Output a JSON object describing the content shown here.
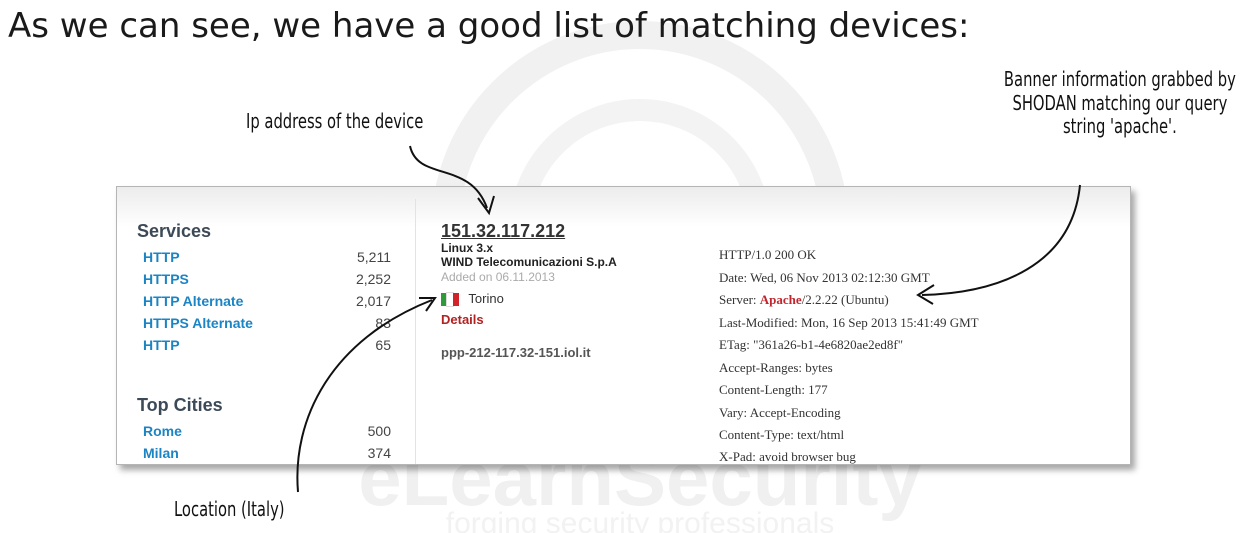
{
  "slide": {
    "title": "As we can see, we have a good list of matching devices:"
  },
  "annotations": {
    "ip_note": "Ip address of the device",
    "banner_note_line1": "Banner information grabbed by",
    "banner_note_line2": "SHODAN matching our query",
    "banner_note_line3": "string 'apache'.",
    "location_note": "Location (Italy)"
  },
  "watermark": {
    "line1": "eLearnSecurity",
    "line2": "forging security professionals"
  },
  "sidebar": {
    "services_title": "Services",
    "services": [
      {
        "name": "HTTP",
        "count": "5,211"
      },
      {
        "name": "HTTPS",
        "count": "2,252"
      },
      {
        "name": "HTTP Alternate",
        "count": "2,017"
      },
      {
        "name": "HTTPS Alternate",
        "count": "83"
      },
      {
        "name": "HTTP",
        "count": "65"
      }
    ],
    "cities_title": "Top Cities",
    "cities": [
      {
        "name": "Rome",
        "count": "500"
      },
      {
        "name": "Milan",
        "count": "374"
      }
    ]
  },
  "result": {
    "ip": "151.32.117.212",
    "os": "Linux 3.x",
    "org": "WIND Telecomunicazioni S.p.A",
    "added": "Added on 06.11.2013",
    "city": "Torino",
    "details": "Details",
    "hostname": "ppp-212-117.32-151.iol.it",
    "flag_colors": [
      "#2e9a3a",
      "#ffffff",
      "#d2232a"
    ]
  },
  "banner": {
    "lines": [
      "HTTP/1.0 200 OK",
      "Date: Wed, 06 Nov 2013 02:12:30 GMT",
      "",
      "Last-Modified: Mon, 16 Sep 2013 15:41:49 GMT",
      "ETag: \"361a26-b1-4e6820ae2ed8f\"",
      "Accept-Ranges: bytes",
      "Content-Length: 177",
      "Vary: Accept-Encoding",
      "Content-Type: text/html",
      "X-Pad: avoid browser bug"
    ],
    "server_prefix": "Server: ",
    "server_highlight": "Apache",
    "server_suffix": "/2.2.22 (Ubuntu)"
  },
  "colors": {
    "link": "#1b84c4",
    "highlight": "#c0262c",
    "details": "#b22222"
  }
}
